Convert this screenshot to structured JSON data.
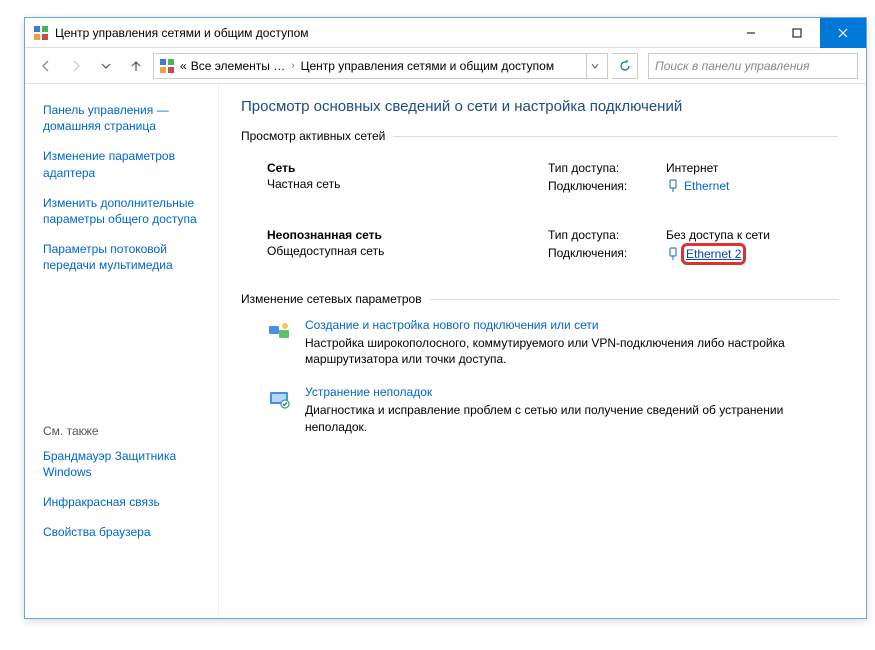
{
  "window": {
    "title": "Центр управления сетями и общим доступом"
  },
  "toolbar": {
    "breadcrumb_prefix": "«",
    "breadcrumb1": "Все элементы …",
    "breadcrumb2": "Центр управления сетями и общим доступом",
    "search_placeholder": "Поиск в панели управления"
  },
  "sidebar": {
    "home": "Панель управления — домашняя страница",
    "links": [
      "Изменение параметров адаптера",
      "Изменить дополнительные параметры общего доступа",
      "Параметры потоковой передачи мультимедиа"
    ],
    "see_also_label": "См. также",
    "see_also": [
      "Брандмауэр Защитника Windows",
      "Инфракрасная связь",
      "Свойства браузера"
    ]
  },
  "main": {
    "heading": "Просмотр основных сведений о сети и настройка подключений",
    "active_networks_label": "Просмотр активных сетей",
    "change_settings_label": "Изменение сетевых параметров",
    "networks": [
      {
        "name": "Сеть",
        "type": "Частная сеть",
        "access_label": "Тип доступа:",
        "access_value": "Интернет",
        "conn_label": "Подключения:",
        "conn_link": "Ethernet"
      },
      {
        "name": "Неопознанная сеть",
        "type": "Общедоступная сеть",
        "access_label": "Тип доступа:",
        "access_value": "Без доступа к сети",
        "conn_label": "Подключения:",
        "conn_link": "Ethernet 2"
      }
    ],
    "actions": [
      {
        "title": "Создание и настройка нового подключения или сети",
        "desc": "Настройка широкополосного, коммутируемого или VPN-подключения либо настройка маршрутизатора или точки доступа."
      },
      {
        "title": "Устранение неполадок",
        "desc": "Диагностика и исправление проблем с сетью или получение сведений об устранении неполадок."
      }
    ]
  }
}
